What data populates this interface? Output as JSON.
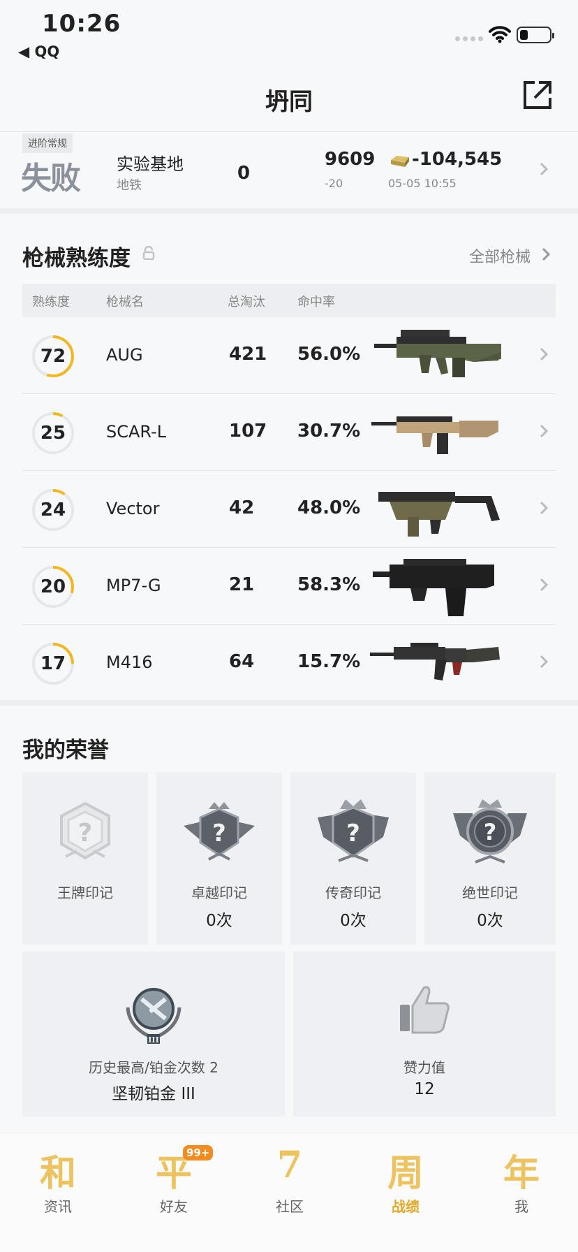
{
  "status_bar": {
    "time": "10:26",
    "back_label": "◀ QQ"
  },
  "header": {
    "title": "坍同"
  },
  "match": {
    "mode_tag": "进阶常规",
    "result": "失败",
    "map": "实验基地",
    "sub": "地铁",
    "kills": "0",
    "score": "9609",
    "score_delta": "-20",
    "coins": "-104,545",
    "date": "05-05 10:55"
  },
  "weapons": {
    "title": "枪械熟练度",
    "all_label": "全部枪械",
    "columns": [
      "熟练度",
      "枪械名",
      "总淘汰",
      "命中率"
    ],
    "rows": [
      {
        "level": "72",
        "name": "AUG",
        "kills": "421",
        "accuracy": "56.0%",
        "progress": 0.55
      },
      {
        "level": "25",
        "name": "SCAR-L",
        "kills": "107",
        "accuracy": "30.7%",
        "progress": 0.08
      },
      {
        "level": "24",
        "name": "Vector",
        "kills": "42",
        "accuracy": "48.0%",
        "progress": 0.1
      },
      {
        "level": "20",
        "name": "MP7-G",
        "kills": "21",
        "accuracy": "58.3%",
        "progress": 0.3
      },
      {
        "level": "17",
        "name": "M416",
        "kills": "64",
        "accuracy": "15.7%",
        "progress": 0.25
      }
    ]
  },
  "honors": {
    "title": "我的荣誉",
    "cards": [
      {
        "label": "王牌印记",
        "value": ""
      },
      {
        "label": "卓越印记",
        "value": "0次"
      },
      {
        "label": "传奇印记",
        "value": "0次"
      },
      {
        "label": "绝世印记",
        "value": "0次"
      }
    ],
    "rank": {
      "label": "历史最高/铂金次数 2",
      "value": "坚韧铂金 III"
    },
    "likes": {
      "label": "赞力值",
      "value": "12"
    }
  },
  "tabbar": {
    "tabs": [
      {
        "glyph": "和",
        "label": "资讯"
      },
      {
        "glyph": "平",
        "label": "好友",
        "badge": "99+"
      },
      {
        "glyph": "7",
        "label": "社区"
      },
      {
        "glyph": "周",
        "label": "战绩"
      },
      {
        "glyph": "年",
        "label": "我"
      }
    ]
  },
  "colors": {
    "accent": "#f2b824",
    "ring_track": "#e6e7ea"
  }
}
